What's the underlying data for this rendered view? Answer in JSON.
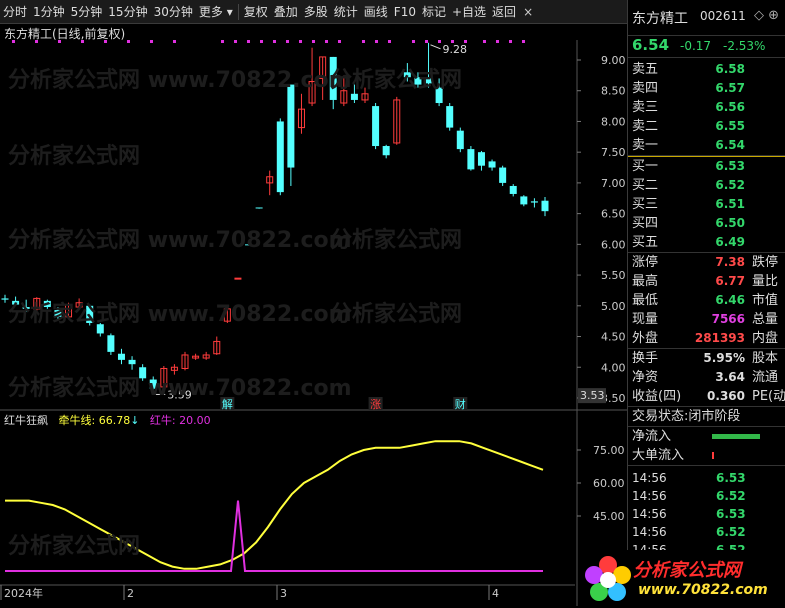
{
  "toolbar": {
    "items": [
      "分时",
      "1分钟",
      "5分钟",
      "15分钟",
      "30分钟",
      "更多",
      "复权",
      "叠加",
      "多股",
      "统计",
      "画线",
      "F10",
      "标记",
      "+自选",
      "返回"
    ],
    "close": "×"
  },
  "chart": {
    "title": "东方精工(日线,前复权)",
    "high_label": "9.28",
    "low_label": "3.59",
    "current_price_tag": "3.53",
    "events": [
      "解",
      "涨",
      "财"
    ],
    "y_ticks": [
      "9.00",
      "8.50",
      "8.00",
      "7.50",
      "7.00",
      "6.50",
      "6.00",
      "5.50",
      "5.00",
      "4.50",
      "4.00",
      "3.50"
    ],
    "colors": {
      "up": "#ff3c3c",
      "down": "#54ffff",
      "line": "#ffff3c",
      "pink": "#e030e0"
    }
  },
  "chart_data": {
    "type": "candlestick",
    "x_labels": [
      "2024年",
      "2",
      "3",
      "4"
    ],
    "candles": [
      {
        "o": 5.12,
        "h": 5.18,
        "l": 5.05,
        "c": 5.1
      },
      {
        "o": 5.08,
        "h": 5.15,
        "l": 5.0,
        "c": 5.02
      },
      {
        "o": 4.98,
        "h": 5.1,
        "l": 4.9,
        "c": 4.95
      },
      {
        "o": 4.95,
        "h": 5.14,
        "l": 4.92,
        "c": 5.12
      },
      {
        "o": 5.08,
        "h": 5.1,
        "l": 4.95,
        "c": 4.98
      },
      {
        "o": 4.93,
        "h": 4.98,
        "l": 4.78,
        "c": 4.82
      },
      {
        "o": 4.82,
        "h": 5.05,
        "l": 4.78,
        "c": 5.02
      },
      {
        "o": 4.98,
        "h": 5.12,
        "l": 4.95,
        "c": 5.05
      },
      {
        "o": 5.0,
        "h": 5.02,
        "l": 4.68,
        "c": 4.72
      },
      {
        "o": 4.7,
        "h": 4.72,
        "l": 4.5,
        "c": 4.55
      },
      {
        "o": 4.52,
        "h": 4.55,
        "l": 4.2,
        "c": 4.25
      },
      {
        "o": 4.22,
        "h": 4.3,
        "l": 4.05,
        "c": 4.12
      },
      {
        "o": 4.12,
        "h": 4.18,
        "l": 3.96,
        "c": 4.05
      },
      {
        "o": 4.0,
        "h": 4.05,
        "l": 3.78,
        "c": 3.82
      },
      {
        "o": 3.8,
        "h": 3.85,
        "l": 3.59,
        "c": 3.65
      },
      {
        "o": 3.68,
        "h": 4.02,
        "l": 3.62,
        "c": 3.98
      },
      {
        "o": 3.95,
        "h": 4.05,
        "l": 3.88,
        "c": 4.0
      },
      {
        "o": 3.98,
        "h": 4.25,
        "l": 3.95,
        "c": 4.2
      },
      {
        "o": 4.15,
        "h": 4.22,
        "l": 4.12,
        "c": 4.18
      },
      {
        "o": 4.15,
        "h": 4.25,
        "l": 4.12,
        "c": 4.2
      },
      {
        "o": 4.22,
        "h": 4.5,
        "l": 4.2,
        "c": 4.42
      },
      {
        "o": 4.75,
        "h": 5.0,
        "l": 4.72,
        "c": 4.95
      },
      {
        "o": 5.45,
        "h": 5.45,
        "l": 5.44,
        "c": 5.45
      },
      {
        "o": 6.0,
        "h": 6.0,
        "l": 5.98,
        "c": 5.99
      },
      {
        "o": 6.6,
        "h": 6.6,
        "l": 6.58,
        "c": 6.59
      },
      {
        "o": 7.0,
        "h": 7.2,
        "l": 6.8,
        "c": 7.1
      },
      {
        "o": 8.0,
        "h": 8.05,
        "l": 6.8,
        "c": 6.85
      },
      {
        "o": 8.6,
        "h": 8.6,
        "l": 6.95,
        "c": 7.25
      },
      {
        "o": 7.9,
        "h": 8.45,
        "l": 7.8,
        "c": 8.2
      },
      {
        "o": 8.3,
        "h": 9.2,
        "l": 8.25,
        "c": 8.65
      },
      {
        "o": 8.7,
        "h": 9.05,
        "l": 8.35,
        "c": 9.05
      },
      {
        "o": 9.05,
        "h": 9.05,
        "l": 8.2,
        "c": 8.35
      },
      {
        "o": 8.3,
        "h": 8.75,
        "l": 8.25,
        "c": 8.5
      },
      {
        "o": 8.45,
        "h": 8.6,
        "l": 8.3,
        "c": 8.35
      },
      {
        "o": 8.35,
        "h": 8.55,
        "l": 8.3,
        "c": 8.45
      },
      {
        "o": 8.25,
        "h": 8.3,
        "l": 7.55,
        "c": 7.6
      },
      {
        "o": 7.6,
        "h": 7.62,
        "l": 7.4,
        "c": 7.45
      },
      {
        "o": 7.65,
        "h": 8.4,
        "l": 7.62,
        "c": 8.35
      },
      {
        "o": 8.8,
        "h": 8.95,
        "l": 8.65,
        "c": 8.72
      },
      {
        "o": 8.72,
        "h": 8.8,
        "l": 8.55,
        "c": 8.6
      },
      {
        "o": 8.7,
        "h": 9.28,
        "l": 8.55,
        "c": 8.62
      },
      {
        "o": 8.55,
        "h": 8.7,
        "l": 8.25,
        "c": 8.3
      },
      {
        "o": 8.25,
        "h": 8.3,
        "l": 7.85,
        "c": 7.9
      },
      {
        "o": 7.85,
        "h": 7.9,
        "l": 7.5,
        "c": 7.55
      },
      {
        "o": 7.55,
        "h": 7.6,
        "l": 7.2,
        "c": 7.22
      },
      {
        "o": 7.5,
        "h": 7.52,
        "l": 7.2,
        "c": 7.28
      },
      {
        "o": 7.35,
        "h": 7.38,
        "l": 7.2,
        "c": 7.25
      },
      {
        "o": 7.25,
        "h": 7.28,
        "l": 6.95,
        "c": 7.0
      },
      {
        "o": 6.95,
        "h": 6.98,
        "l": 6.78,
        "c": 6.82
      },
      {
        "o": 6.78,
        "h": 6.8,
        "l": 6.62,
        "c": 6.65
      },
      {
        "o": 6.7,
        "h": 6.75,
        "l": 6.6,
        "c": 6.68
      },
      {
        "o": 6.71,
        "h": 6.77,
        "l": 6.46,
        "c": 6.54
      }
    ],
    "indicator": {
      "title": "红牛狂飙",
      "series": [
        {
          "name": "牵牛线",
          "value": "66.78",
          "arrow": "↓",
          "color": "#ffff3c"
        },
        {
          "name": "红牛",
          "value": "20.00",
          "color": "#e030e0"
        }
      ],
      "y_ticks": [
        "75.00",
        "60.00",
        "45.00"
      ],
      "line_values": [
        52,
        52,
        52,
        51,
        50,
        48,
        45,
        42,
        39,
        36,
        33,
        30,
        27,
        24,
        22,
        21,
        21,
        22,
        23,
        25,
        28,
        33,
        40,
        48,
        55,
        60,
        63,
        66,
        70,
        73,
        75,
        76,
        76,
        76,
        77,
        78,
        79,
        79,
        79,
        78,
        76,
        74,
        72,
        70,
        68,
        66
      ]
    }
  },
  "quote": {
    "name": "东方精工",
    "code": "002611",
    "icons": "◇ ⊕",
    "price": "6.54",
    "change": "-0.17",
    "pct": "-2.53%",
    "asks": [
      {
        "label": "卖五",
        "price": "6.58"
      },
      {
        "label": "卖四",
        "price": "6.57"
      },
      {
        "label": "卖三",
        "price": "6.56"
      },
      {
        "label": "卖二",
        "price": "6.55"
      },
      {
        "label": "卖一",
        "price": "6.54"
      }
    ],
    "bids": [
      {
        "label": "买一",
        "price": "6.53"
      },
      {
        "label": "买二",
        "price": "6.52"
      },
      {
        "label": "买三",
        "price": "6.51"
      },
      {
        "label": "买四",
        "price": "6.50"
      },
      {
        "label": "买五",
        "price": "6.49"
      }
    ],
    "stats": [
      {
        "l": "涨停",
        "v": "7.38",
        "c": "r",
        "l2": "跌停"
      },
      {
        "l": "最高",
        "v": "6.77",
        "c": "r",
        "l2": "量比"
      },
      {
        "l": "最低",
        "v": "6.46",
        "c": "g",
        "l2": "市值"
      },
      {
        "l": "现量",
        "v": "7566",
        "c": "m",
        "l2": "总量"
      },
      {
        "l": "外盘",
        "v": "281393",
        "c": "r",
        "l2": "内盘"
      }
    ],
    "fund": [
      {
        "l": "换手",
        "v": "5.95%",
        "l2": "股本"
      },
      {
        "l": "净资",
        "v": "3.64",
        "l2": "流通"
      },
      {
        "l": "收益(四)",
        "v": "0.360",
        "l2": "PE(动"
      }
    ],
    "status": "交易状态:闭市阶段",
    "flows": [
      {
        "l": "净流入"
      },
      {
        "l": "大单流入"
      }
    ],
    "ticks": [
      {
        "t": "14:56",
        "v": "6.53"
      },
      {
        "t": "14:56",
        "v": "6.52"
      },
      {
        "t": "14:56",
        "v": "6.53"
      },
      {
        "t": "14:56",
        "v": "6.52"
      },
      {
        "t": "14:56",
        "v": "6.52"
      }
    ]
  },
  "watermark": [
    "分析家公式网",
    "www.70822.com"
  ],
  "logo": {
    "t1": "分析家公式网",
    "t2": "www.70822.com"
  }
}
